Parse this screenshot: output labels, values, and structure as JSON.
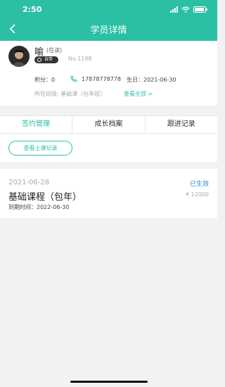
{
  "status_bar": {
    "time": "2:50",
    "battery_level": 0.9
  },
  "header": {
    "title": "学员详情",
    "back_icon": "chevron-left-icon"
  },
  "student": {
    "name": "喻",
    "status": "(在读)",
    "badge": "自带",
    "number": "No.1198",
    "points_label": "积分：",
    "points_value": "0",
    "phone": "17878778778",
    "birthday_label": "生日：",
    "birthday": "2021-06-30",
    "class_label": "所在班级: 基础课（包年班）",
    "view_all": "查看全部 >"
  },
  "tabs": [
    {
      "label": "签约管理",
      "active": true
    },
    {
      "label": "成长档案",
      "active": false
    },
    {
      "label": "跟进记录",
      "active": false
    }
  ],
  "history_button": "查看上课记录",
  "contract": {
    "date": "2021-06-28",
    "status": "已生效",
    "course": "基础课程（包年）",
    "price": "¥ 12000",
    "expire": "到期时间：2022-06-30"
  },
  "colors": {
    "accent": "#2bbfa4",
    "status_blue": "#2a8fd0",
    "background": "#f2f2f2"
  }
}
